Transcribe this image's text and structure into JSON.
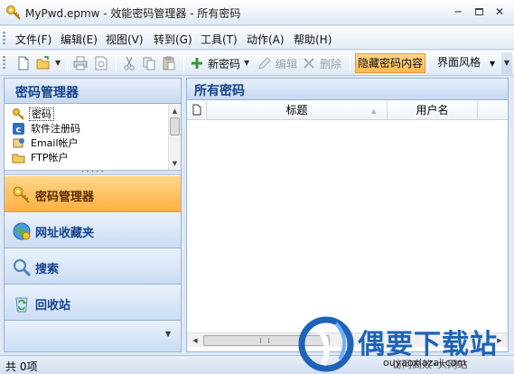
{
  "window": {
    "title": "MyPwd.epmw - 效能密码管理器 - 所有密码",
    "minimize": "─",
    "close": "✕"
  },
  "menu": [
    "文件(F)",
    "编辑(E)",
    "视图(V)",
    "转到(G)",
    "工具(T)",
    "动作(A)",
    "帮助(H)"
  ],
  "toolbar": {
    "new_password": "新密码",
    "edit": "编辑",
    "delete": "删除",
    "hide_content": "隐藏密码内容",
    "interface_style": "界面风格"
  },
  "left_panel": {
    "title": "密码管理器",
    "tree_items": [
      {
        "label": "密码",
        "icon": "key-icon",
        "selected": true
      },
      {
        "label": "软件注册码",
        "icon": "c-badge-icon",
        "selected": false
      },
      {
        "label": "Email帐户",
        "icon": "email-icon",
        "selected": false
      },
      {
        "label": "FTP帐户",
        "icon": "ftp-icon",
        "selected": false
      }
    ],
    "nav_buttons": [
      {
        "label": "密码管理器",
        "icon": "key-icon",
        "active": true
      },
      {
        "label": "网址收藏夹",
        "icon": "globe-icon",
        "active": false
      },
      {
        "label": "搜索",
        "icon": "magnifier-icon",
        "active": false
      },
      {
        "label": "回收站",
        "icon": "recycle-bin-icon",
        "active": false
      }
    ]
  },
  "right_panel": {
    "title": "所有密码",
    "columns": [
      "标题",
      "用户名"
    ]
  },
  "status": {
    "text": "共 0项"
  },
  "watermark": {
    "title": "偶要下载站",
    "subtitle": "ouyaoxiazai.com",
    "subtitle_overlay": "访问高效•大网站"
  },
  "colors": {
    "accent_orange": "#ffb042",
    "header_blue": "#15428b",
    "panel_border": "#99b4d1"
  }
}
